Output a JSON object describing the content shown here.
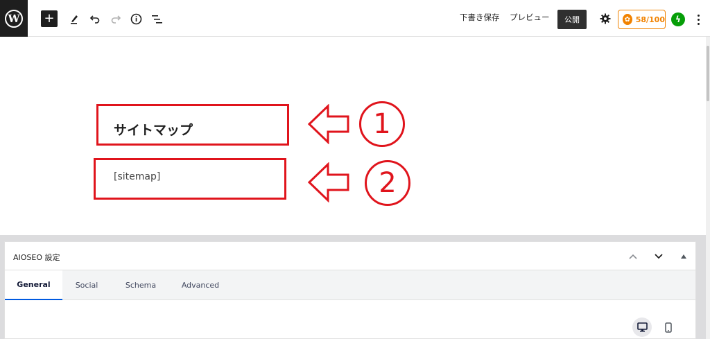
{
  "toolbar": {
    "logo_letter": "W",
    "add_icon": "plus-icon",
    "tools_icon": "pencil-icon",
    "undo_icon": "undo-icon",
    "redo_icon": "redo-icon",
    "info_icon": "info-icon",
    "outline_icon": "list-view-icon",
    "save_draft_label": "下書き保存",
    "preview_label": "プレビュー",
    "publish_label": "公開",
    "settings_icon": "gear-icon",
    "seo_score": "58/100",
    "jetpack_icon": "jetpack-icon",
    "more_icon": "more-vertical-icon"
  },
  "editor": {
    "heading_text": "サイトマップ",
    "shortcode_text": "[sitemap]"
  },
  "annotations": {
    "first_number": "1",
    "second_number": "2",
    "color": "#e0141c"
  },
  "aioseo_panel": {
    "title": "AIOSEO 設定",
    "tabs": [
      "General",
      "Social",
      "Schema",
      "Advanced"
    ],
    "active_tab": "General",
    "desktop_icon": "desktop-icon",
    "mobile_icon": "mobile-icon"
  },
  "colors": {
    "accent_tab": "#005ae0",
    "seo_score": "#f18200",
    "jetpack": "#069e08"
  }
}
